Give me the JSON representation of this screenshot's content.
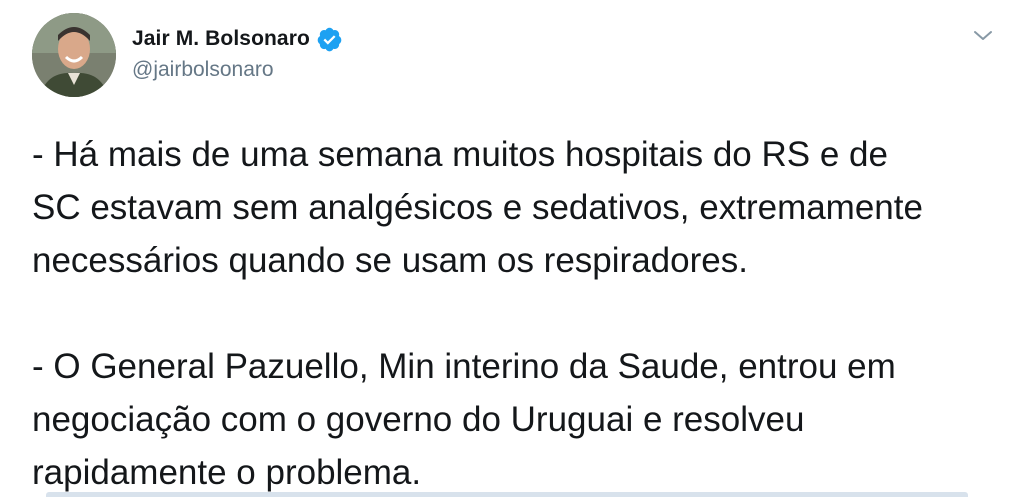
{
  "tweet": {
    "author": {
      "display_name": "Jair M. Bolsonaro",
      "handle": "@jairbolsonaro",
      "verified": true,
      "verified_icon": "verified-badge-icon"
    },
    "menu_icon": "chevron-down-icon",
    "text_paragraph_1": "- Há mais de uma semana muitos hospitais do RS e de\nSC estavam sem analgésicos e sedativos, extremamente\nnecessários quando se usam os respiradores.",
    "text_paragraph_2": "- O General Pazuello, Min interino da Saude, entrou em\nnegociação com o governo do Uruguai e resolveu\nrapidamente o problema."
  },
  "colors": {
    "text_primary": "#14171a",
    "text_secondary": "#657786",
    "verified_blue": "#1da1f2"
  }
}
